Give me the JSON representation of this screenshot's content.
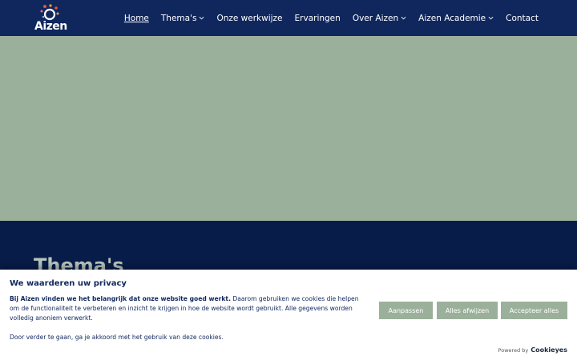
{
  "header": {
    "logo_text": "Aizen",
    "nav": [
      {
        "label": "Home",
        "active": true,
        "dropdown": false
      },
      {
        "label": "Thema's",
        "active": false,
        "dropdown": true
      },
      {
        "label": "Onze werkwijze",
        "active": false,
        "dropdown": false
      },
      {
        "label": "Ervaringen",
        "active": false,
        "dropdown": false
      },
      {
        "label": "Over Aizen",
        "active": false,
        "dropdown": true
      },
      {
        "label": "Aizen Academie",
        "active": false,
        "dropdown": true
      },
      {
        "label": "Contact",
        "active": false,
        "dropdown": false
      }
    ]
  },
  "main": {
    "section_title": "Thema's"
  },
  "cookie_banner": {
    "title": "We waarderen uw privacy",
    "intro_bold": "Bij Aizen vinden we het belangrijk dat onze website goed werkt.",
    "intro_rest": " Daarom gebruiken we cookies die helpen om de functionaliteit te verbeteren en inzicht te krijgen in hoe de website wordt gebruikt. Alle gegevens worden volledig anoniem verwerkt.",
    "consent_note": "Door verder te gaan, ga je akkoord met het gebruik van deze cookies.",
    "buttons": {
      "customize": "Aanpassen",
      "reject_all": "Alles afwijzen",
      "accept_all": "Accepteer alles"
    },
    "powered_by": "Powered by",
    "powered_brand": "Cookieyes"
  },
  "colors": {
    "navbar": "#10275e",
    "hero": "#9bb09a",
    "section": "#081c4a",
    "button": "#9bb09a",
    "text_dark": "#10275e"
  }
}
